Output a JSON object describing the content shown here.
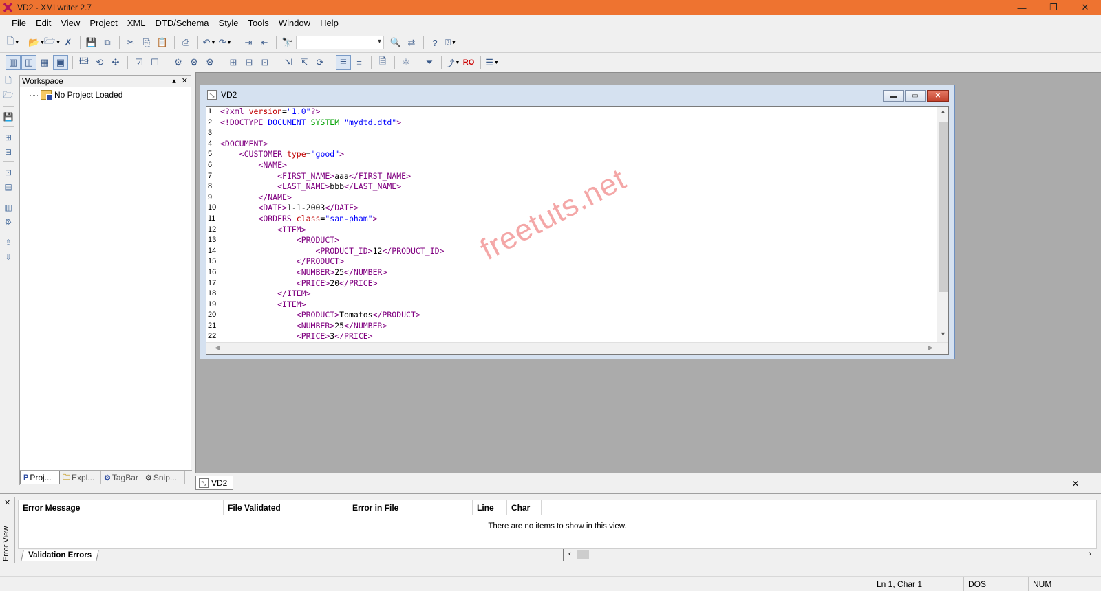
{
  "window": {
    "title": "VD2 - XMLwriter 2.7",
    "controls": [
      "—",
      "❐",
      "✕"
    ]
  },
  "menu": [
    "File",
    "Edit",
    "View",
    "Project",
    "XML",
    "DTD/Schema",
    "Style",
    "Tools",
    "Window",
    "Help"
  ],
  "toolbar1": {
    "icons": [
      "new-file-icon",
      "open-icon",
      "open-project-icon",
      "close-icon",
      "save-icon",
      "save-all-icon",
      "cut-icon",
      "copy-icon",
      "paste-icon",
      "print-icon",
      "undo-icon",
      "redo-icon",
      "indent-icon",
      "outdent-icon",
      "find-icon",
      "find-next-icon",
      "find-replace-icon",
      "context-help-icon",
      "help-icon"
    ],
    "combo_value": ""
  },
  "toolbar2": {
    "ro_label": "RO"
  },
  "workspace": {
    "title": "Workspace",
    "tree_item": "No Project Loaded",
    "tabs": [
      "Proj...",
      "Expl...",
      "TagBar",
      "Snip..."
    ]
  },
  "document": {
    "title": "VD2",
    "lines": [
      "<?xml version=\"1.0\"?>",
      "<!DOCTYPE DOCUMENT SYSTEM \"mydtd.dtd\">",
      "",
      "<DOCUMENT>",
      "    <CUSTOMER type=\"good\">",
      "        <NAME>",
      "            <FIRST_NAME>aaa</FIRST_NAME>",
      "            <LAST_NAME>bbb</LAST_NAME>",
      "        </NAME>",
      "        <DATE>1-1-2003</DATE>",
      "        <ORDERS class=\"san-pham\">",
      "            <ITEM>",
      "                <PRODUCT>",
      "                    <PRODUCT_ID>12</PRODUCT_ID>",
      "                </PRODUCT>",
      "                <NUMBER>25</NUMBER>",
      "                <PRICE>20</PRICE>",
      "            </ITEM>",
      "            <ITEM>",
      "                <PRODUCT>Tomatos</PRODUCT>",
      "                <NUMBER>25</NUMBER>",
      "                <PRICE>3</PRICE>"
    ]
  },
  "watermark": "freetuts.net",
  "doc_tab": "VD2",
  "error_view": {
    "side_label": "Error View",
    "columns": [
      "Error Message",
      "File Validated",
      "Error in File",
      "Line",
      "Char"
    ],
    "empty_text": "There are no items to show in this view.",
    "tab": "Validation Errors"
  },
  "status": {
    "position": "Ln 1, Char 1",
    "format": "DOS",
    "num": "NUM"
  }
}
